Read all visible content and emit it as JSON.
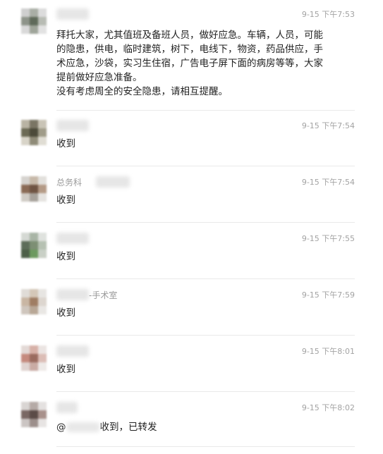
{
  "messages": [
    {
      "time": "9-15 下午7:53",
      "text": "拜托大家，尤其值班及备班人员，做好应急。车辆，人员，可能\n的隐患，供电，临时建筑，树下，电线下，物资，药品供应，手\n术应急，沙袋，实习生住宿，广告电子屏下面的病房等等，大家\n提前做好应急准备。\n没有考虑周全的安全隐患，请相互提醒。"
    },
    {
      "time": "9-15 下午7:54",
      "text": "收到"
    },
    {
      "time": "9-15 下午7:54",
      "sender": "总务科",
      "text": "收到"
    },
    {
      "time": "9-15 下午7:55",
      "text": "收到"
    },
    {
      "time": "9-15 下午7:59",
      "sender": "-手术室",
      "text": "收到"
    },
    {
      "time": "9-15 下午8:01",
      "text": "收到"
    },
    {
      "time": "9-15 下午8:02",
      "mention": "@",
      "text": "收到，已转发"
    }
  ]
}
